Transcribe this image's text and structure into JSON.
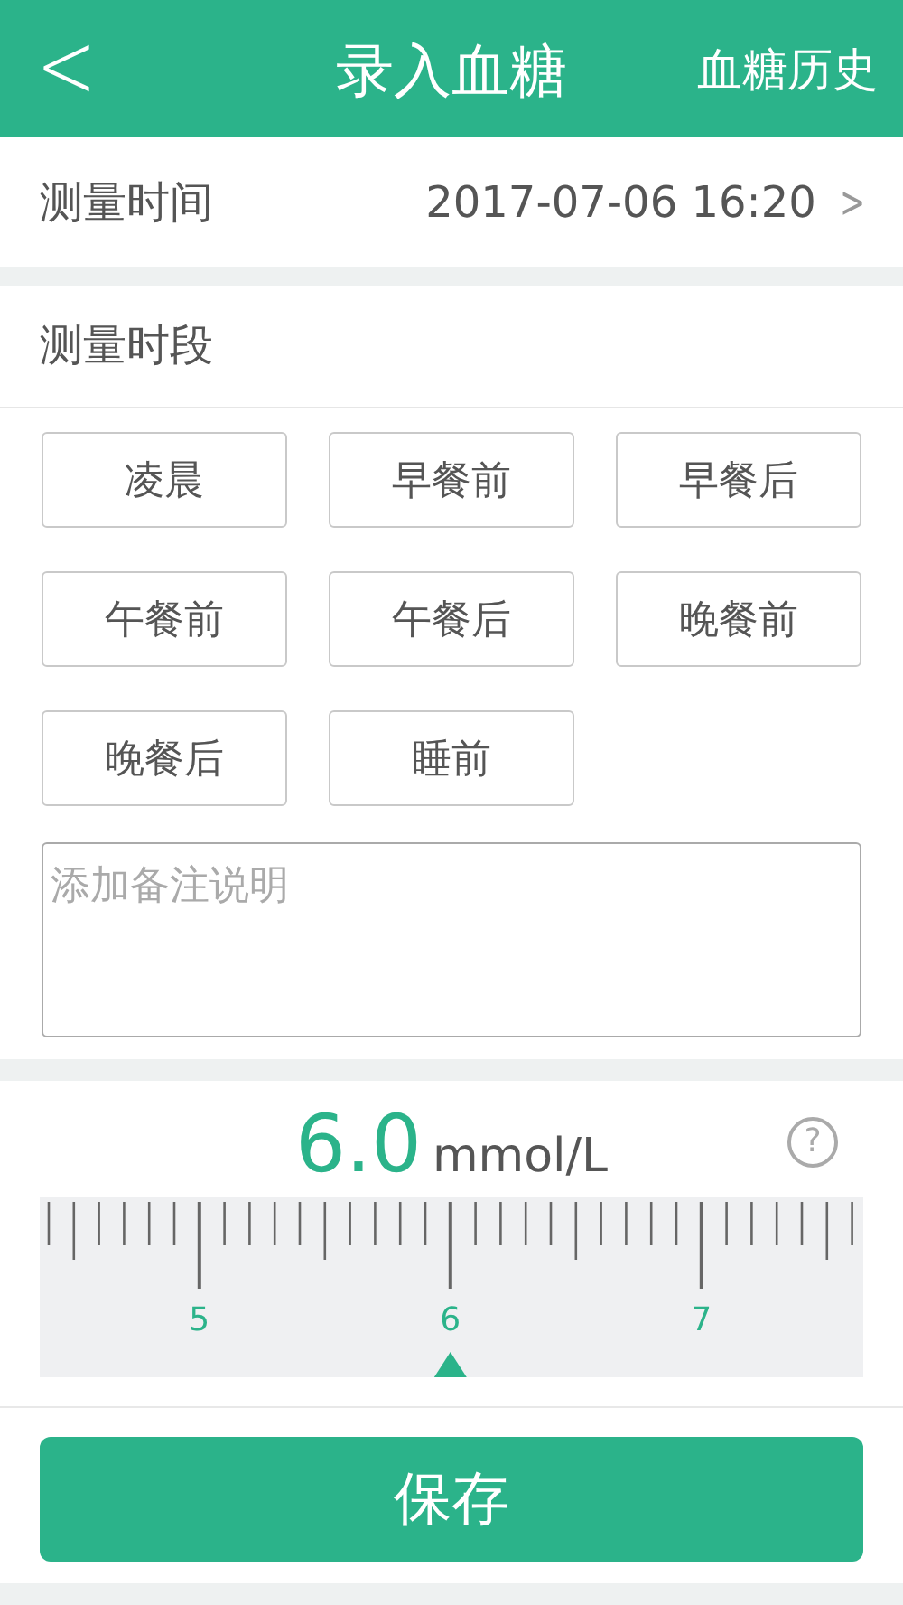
{
  "header": {
    "back": "<",
    "title": "录入血糖",
    "action": "血糖历史"
  },
  "time_row": {
    "label": "测量时间",
    "value": "2017-07-06 16:20",
    "chevron": ">"
  },
  "period": {
    "title": "测量时段",
    "options": [
      {
        "label": "凌晨",
        "selected": false
      },
      {
        "label": "早餐前",
        "selected": false
      },
      {
        "label": "早餐后",
        "selected": false
      },
      {
        "label": "午餐前",
        "selected": false
      },
      {
        "label": "午餐后",
        "selected": false
      },
      {
        "label": "晚餐前",
        "selected": false
      },
      {
        "label": "晚餐后",
        "selected": false
      },
      {
        "label": "睡前",
        "selected": false
      }
    ],
    "note": {
      "placeholder": "添加备注说明"
    }
  },
  "reading": {
    "value": "6.0",
    "unit": "mmol/L",
    "help": "?",
    "scale_labels": [
      "5",
      "6",
      "7"
    ]
  },
  "save_button": "保存"
}
